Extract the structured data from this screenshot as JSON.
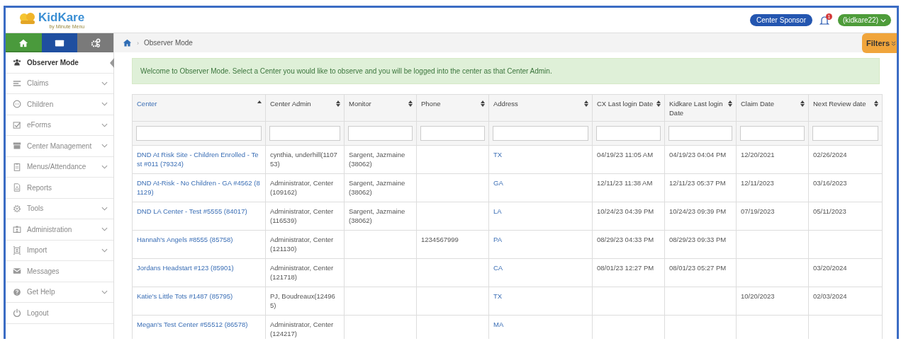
{
  "header": {
    "logo_text": "KidKare",
    "logo_tagline": "by Minute Menu",
    "role_button": "Center Sponsor",
    "notification_count": "1",
    "user_menu": "(kidkare22)"
  },
  "top_tabs": [
    {
      "color": "#4a9a3c",
      "selected": true
    },
    {
      "color": "#1f4fa0",
      "selected": false
    },
    {
      "color": "#7a7a7a",
      "selected": false
    }
  ],
  "sidebar": {
    "items": [
      {
        "label": "Observer Mode",
        "selected": true,
        "expandable": false
      },
      {
        "label": "Claims",
        "selected": false,
        "expandable": true
      },
      {
        "label": "Children",
        "selected": false,
        "expandable": true
      },
      {
        "label": "eForms",
        "selected": false,
        "expandable": true
      },
      {
        "label": "Center Management",
        "selected": false,
        "expandable": true
      },
      {
        "label": "Menus/Attendance",
        "selected": false,
        "expandable": true
      },
      {
        "label": "Reports",
        "selected": false,
        "expandable": false
      },
      {
        "label": "Tools",
        "selected": false,
        "expandable": true
      },
      {
        "label": "Administration",
        "selected": false,
        "expandable": true
      },
      {
        "label": "Import",
        "selected": false,
        "expandable": true
      },
      {
        "label": "Messages",
        "selected": false,
        "expandable": false
      },
      {
        "label": "Get Help",
        "selected": false,
        "expandable": true
      },
      {
        "label": "Logout",
        "selected": false,
        "expandable": false
      }
    ]
  },
  "breadcrumb": {
    "separator": "›",
    "current": "Observer Mode"
  },
  "filters_tab": "Filters",
  "alert": "Welcome to Observer Mode. Select a Center you would like to observe and you will be logged into the center as that Center Admin.",
  "table": {
    "columns": [
      {
        "label": "Center",
        "sorted": true
      },
      {
        "label": "Center Admin",
        "sorted": false
      },
      {
        "label": "Monitor",
        "sorted": false
      },
      {
        "label": "Phone",
        "sorted": false
      },
      {
        "label": "Address",
        "sorted": false
      },
      {
        "label": "CX Last login Date",
        "sorted": false
      },
      {
        "label": "Kidkare Last login Date",
        "sorted": false
      },
      {
        "label": "Claim Date",
        "sorted": false
      },
      {
        "label": "Next Review date",
        "sorted": false
      }
    ],
    "rows": [
      [
        "DND At Risk Site - Children Enrolled - Test #011 (79324)",
        "cynthia, underhill(110753)",
        "Sargent, Jazmaine (38062)",
        "",
        "TX",
        "04/19/23 11:05 AM",
        "04/19/23 04:04 PM",
        "12/20/2021",
        "02/26/2024"
      ],
      [
        "DND At-Risk - No Children - GA #4562 (81129)",
        "Administrator, Center (109162)",
        "Sargent, Jazmaine (38062)",
        "",
        "GA",
        "12/11/23 11:38 AM",
        "12/11/23 05:37 PM",
        "12/11/2023",
        "03/16/2023"
      ],
      [
        "DND LA Center - Test #5555 (84017)",
        "Administrator, Center (116539)",
        "Sargent, Jazmaine (38062)",
        "",
        "LA",
        "10/24/23 04:39 PM",
        "10/24/23 09:39 PM",
        "07/19/2023",
        "05/11/2023"
      ],
      [
        "Hannah's Angels #8555 (85758)",
        "Administrator, Center (121130)",
        "",
        "1234567999",
        "PA",
        "08/29/23 04:33 PM",
        "08/29/23 09:33 PM",
        "",
        ""
      ],
      [
        "Jordans Headstart #123 (85901)",
        "Administrator, Center (121718)",
        "",
        "",
        "CA",
        "08/01/23 12:27 PM",
        "08/01/23 05:27 PM",
        "",
        "03/20/2024"
      ],
      [
        "Katie's Little Tots #1487 (85795)",
        "PJ, Boudreaux(124965)",
        "",
        "",
        "TX",
        "",
        "",
        "10/20/2023",
        "02/03/2024"
      ],
      [
        "Megan's Test Center #55512 (86578)",
        "Administrator, Center (124217)",
        "",
        "",
        "MA",
        "",
        "",
        "",
        ""
      ]
    ]
  }
}
